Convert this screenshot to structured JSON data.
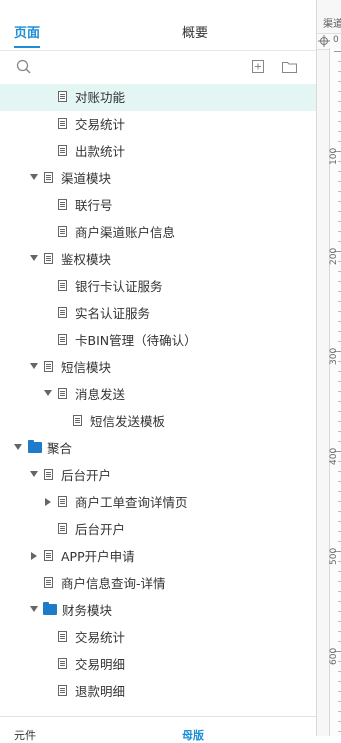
{
  "tabs": [
    {
      "label": "页面",
      "active": true
    },
    {
      "label": "概要",
      "active": false
    }
  ],
  "toolbar": {
    "search_icon": "search-icon",
    "add_page_icon": "add-page-icon",
    "add_folder_icon": "add-folder-icon"
  },
  "tree": [
    {
      "label": "对账功能",
      "type": "page",
      "level": 2,
      "expand": "none",
      "selected": true
    },
    {
      "label": "交易统计",
      "type": "page",
      "level": 2,
      "expand": "none"
    },
    {
      "label": "出款统计",
      "type": "page",
      "level": 2,
      "expand": "none"
    },
    {
      "label": "渠道模块",
      "type": "page",
      "level": 1,
      "expand": "open"
    },
    {
      "label": "联行号",
      "type": "page",
      "level": 2,
      "expand": "none"
    },
    {
      "label": "商户渠道账户信息",
      "type": "page",
      "level": 2,
      "expand": "none"
    },
    {
      "label": "鉴权模块",
      "type": "page",
      "level": 1,
      "expand": "open"
    },
    {
      "label": "银行卡认证服务",
      "type": "page",
      "level": 2,
      "expand": "none"
    },
    {
      "label": "实名认证服务",
      "type": "page",
      "level": 2,
      "expand": "none"
    },
    {
      "label": "卡BIN管理（待确认）",
      "type": "page",
      "level": 2,
      "expand": "none"
    },
    {
      "label": "短信模块",
      "type": "page",
      "level": 1,
      "expand": "open"
    },
    {
      "label": "消息发送",
      "type": "page",
      "level": 2,
      "expand": "open"
    },
    {
      "label": "短信发送模板",
      "type": "page",
      "level": 3,
      "expand": "none"
    },
    {
      "label": "聚合",
      "type": "folder",
      "level": 0,
      "expand": "open"
    },
    {
      "label": "后台开户",
      "type": "page",
      "level": 1,
      "expand": "open"
    },
    {
      "label": "商户工单查询详情页",
      "type": "page",
      "level": 2,
      "expand": "closed"
    },
    {
      "label": "后台开户",
      "type": "page",
      "level": 2,
      "expand": "none"
    },
    {
      "label": "APP开户申请",
      "type": "page",
      "level": 1,
      "expand": "closed"
    },
    {
      "label": "商户信息查询-详情",
      "type": "page",
      "level": 1,
      "expand": "none"
    },
    {
      "label": "财务模块",
      "type": "folder",
      "level": 1,
      "expand": "open"
    },
    {
      "label": "交易统计",
      "type": "page",
      "level": 2,
      "expand": "none"
    },
    {
      "label": "交易明细",
      "type": "page",
      "level": 2,
      "expand": "none"
    },
    {
      "label": "退款明细",
      "type": "page",
      "level": 2,
      "expand": "none"
    }
  ],
  "bottom": {
    "left_label": "元件",
    "right_label": "母版"
  },
  "ruler": {
    "header": "渠道",
    "ticks": [
      "100",
      "200",
      "300",
      "400",
      "500",
      "600"
    ]
  },
  "colors": {
    "accent": "#1e8fd6",
    "selected_row": "#e3f6f4",
    "folder": "#1e7bc9"
  }
}
